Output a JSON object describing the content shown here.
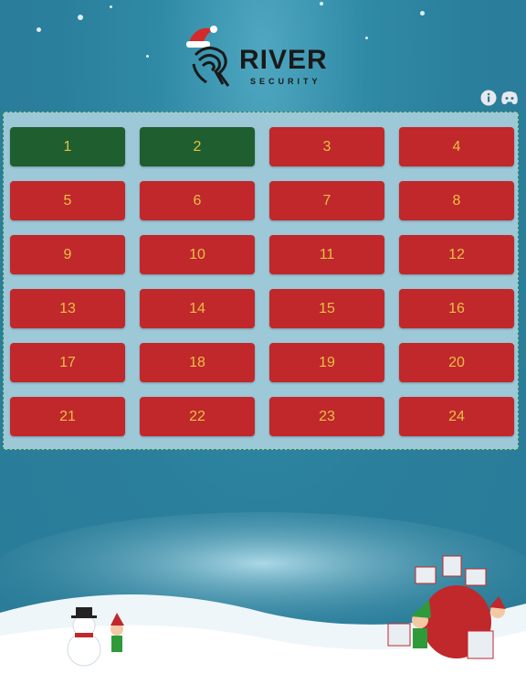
{
  "brand": {
    "name": "RIVER",
    "subtitle": "SECURITY"
  },
  "header_icons": [
    {
      "name": "info-icon"
    },
    {
      "name": "discord-icon"
    }
  ],
  "days": [
    {
      "label": "1",
      "state": "opened"
    },
    {
      "label": "2",
      "state": "opened"
    },
    {
      "label": "3",
      "state": "closed"
    },
    {
      "label": "4",
      "state": "closed"
    },
    {
      "label": "5",
      "state": "closed"
    },
    {
      "label": "6",
      "state": "closed"
    },
    {
      "label": "7",
      "state": "closed"
    },
    {
      "label": "8",
      "state": "closed"
    },
    {
      "label": "9",
      "state": "closed"
    },
    {
      "label": "10",
      "state": "closed"
    },
    {
      "label": "11",
      "state": "closed"
    },
    {
      "label": "12",
      "state": "closed"
    },
    {
      "label": "13",
      "state": "closed"
    },
    {
      "label": "14",
      "state": "closed"
    },
    {
      "label": "15",
      "state": "closed"
    },
    {
      "label": "16",
      "state": "closed"
    },
    {
      "label": "17",
      "state": "closed"
    },
    {
      "label": "18",
      "state": "closed"
    },
    {
      "label": "19",
      "state": "closed"
    },
    {
      "label": "20",
      "state": "closed"
    },
    {
      "label": "21",
      "state": "closed"
    },
    {
      "label": "22",
      "state": "closed"
    },
    {
      "label": "23",
      "state": "closed"
    },
    {
      "label": "24",
      "state": "closed"
    }
  ],
  "colors": {
    "closed": "#c0282b",
    "opened": "#1f5e2f",
    "number_text": "#e7c043",
    "panel": "#9dc8d8"
  }
}
